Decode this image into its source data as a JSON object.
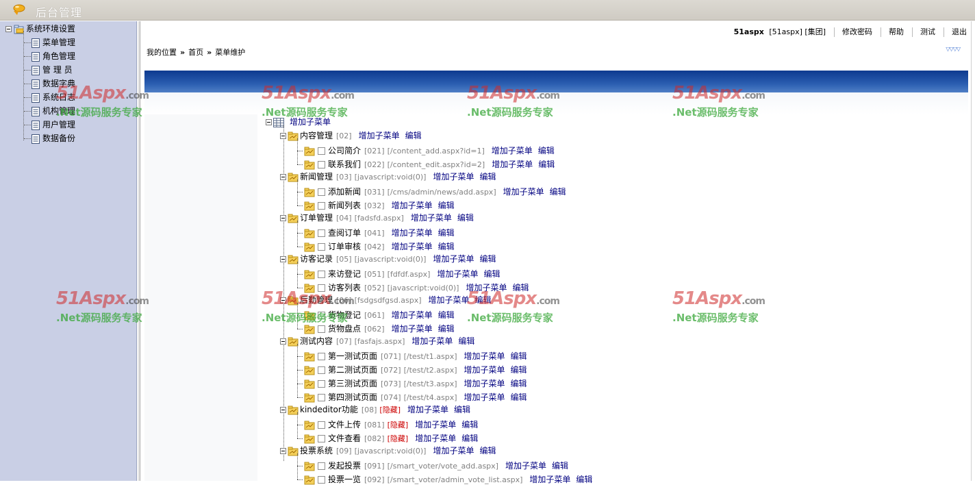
{
  "app": {
    "title": "后台管理"
  },
  "sidebar": {
    "root": "系统环境设置",
    "items": [
      {
        "label": "菜单管理"
      },
      {
        "label": "角色管理"
      },
      {
        "label": "管 理 员"
      },
      {
        "label": "数据字典"
      },
      {
        "label": "系统日志"
      },
      {
        "label": "机构管理"
      },
      {
        "label": "用户管理"
      },
      {
        "label": "数据备份"
      }
    ]
  },
  "topnav": {
    "user": "51aspx",
    "detail": "[51aspx] [集团]",
    "change_password": "修改密码",
    "help": "帮助",
    "test": "测试",
    "logout": "退出"
  },
  "breadcrumb": {
    "label": "我的位置",
    "sep": "»",
    "home": "首页",
    "current": "菜单维护"
  },
  "watermark": {
    "brand": "51Aspx",
    "tld": ".com",
    "slogan": ".Net源码服务专家"
  },
  "actions": {
    "add": "增加子菜单",
    "edit": "编辑"
  },
  "tree": {
    "root_label": "增加子菜单",
    "groups": [
      {
        "name": "内容管理",
        "code": "[02]",
        "url": "",
        "children": [
          {
            "name": "公司简介",
            "code": "[021]",
            "url": "[/content_add.aspx?id=1]"
          },
          {
            "name": "联系我们",
            "code": "[022]",
            "url": "[/content_edit.aspx?id=2]"
          }
        ]
      },
      {
        "name": "新闻管理",
        "code": "[03]",
        "url": "[javascript:void(0)]",
        "children": [
          {
            "name": "添加新闻",
            "code": "[031]",
            "url": "[/cms/admin/news/add.aspx]"
          },
          {
            "name": "新闻列表",
            "code": "[032]",
            "url": ""
          }
        ]
      },
      {
        "name": "订单管理",
        "code": "[04]",
        "url": "[fadsfd.aspx]",
        "children": [
          {
            "name": "查阅订单",
            "code": "[041]",
            "url": ""
          },
          {
            "name": "订单审核",
            "code": "[042]",
            "url": ""
          }
        ]
      },
      {
        "name": "访客记录",
        "code": "[05]",
        "url": "[javascript:void(0)]",
        "children": [
          {
            "name": "来访登记",
            "code": "[051]",
            "url": "[fdfdf.aspx]"
          },
          {
            "name": "访客列表",
            "code": "[052]",
            "url": "[javascript:void(0)]"
          }
        ]
      },
      {
        "name": "后勤管理",
        "code": "[06]",
        "url": "[fsdgsdfgsd.aspx]",
        "children": [
          {
            "name": "货物登记",
            "code": "[061]",
            "url": ""
          },
          {
            "name": "货物盘点",
            "code": "[062]",
            "url": ""
          }
        ]
      },
      {
        "name": "测试内容",
        "code": "[07]",
        "url": "[fasfajs.aspx]",
        "children": [
          {
            "name": "第一测试页面",
            "code": "[071]",
            "url": "[/test/t1.aspx]"
          },
          {
            "name": "第二测试页面",
            "code": "[072]",
            "url": "[/test/t2.aspx]"
          },
          {
            "name": "第三测试页面",
            "code": "[073]",
            "url": "[/test/t3.aspx]"
          },
          {
            "name": "第四测试页面",
            "code": "[074]",
            "url": "[/test/t4.aspx]"
          }
        ]
      },
      {
        "name": "kindeditor功能",
        "code": "[08]",
        "hidden": "[隐藏]",
        "url": "",
        "children": [
          {
            "name": "文件上传",
            "code": "[081]",
            "hidden": "[隐藏]",
            "url": ""
          },
          {
            "name": "文件查看",
            "code": "[082]",
            "hidden": "[隐藏]",
            "url": ""
          }
        ]
      },
      {
        "name": "投票系统",
        "code": "[09]",
        "url": "[javascript:void(0)]",
        "children": [
          {
            "name": "发起投票",
            "code": "[091]",
            "url": "[/smart_voter/vote_add.aspx]"
          },
          {
            "name": "投票一览",
            "code": "[092]",
            "url": "[/smart_voter/admin_vote_list.aspx]"
          }
        ]
      }
    ]
  }
}
